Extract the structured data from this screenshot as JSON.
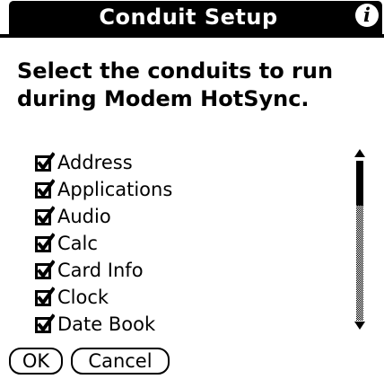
{
  "title_bar": {
    "title": "Conduit Setup",
    "info_icon": "info-icon",
    "info_glyph": "i"
  },
  "prompt": "Select the conduits to run\nduring Modem HotSync.",
  "conduits": [
    {
      "label": "Address",
      "checked": true
    },
    {
      "label": "Applications",
      "checked": true
    },
    {
      "label": "Audio",
      "checked": true
    },
    {
      "label": "Calc",
      "checked": true
    },
    {
      "label": "Card Info",
      "checked": true
    },
    {
      "label": "Clock",
      "checked": true
    },
    {
      "label": "Date Book",
      "checked": true
    }
  ],
  "scrollbar": {
    "up_icon": "arrow-up-icon",
    "down_icon": "arrow-down-icon"
  },
  "buttons": {
    "ok_label": "OK",
    "cancel_label": "Cancel"
  },
  "colors": {
    "foreground": "#000000",
    "background": "#ffffff"
  }
}
